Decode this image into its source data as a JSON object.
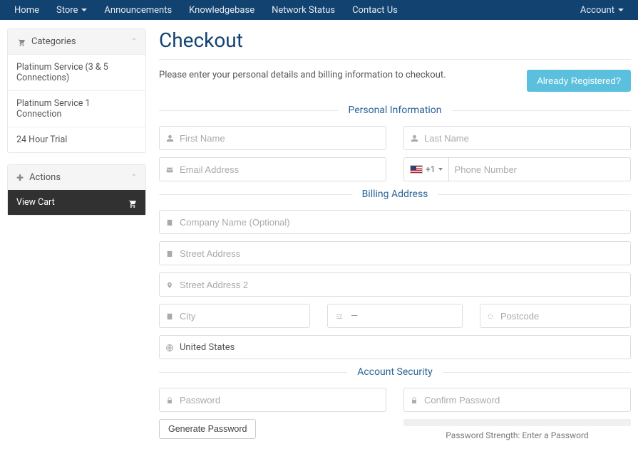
{
  "nav": {
    "left": [
      "Home",
      "Store",
      "Announcements",
      "Knowledgebase",
      "Network Status",
      "Contact Us"
    ],
    "right": "Account"
  },
  "sidebar": {
    "categories": {
      "title": "Categories",
      "items": [
        "Platinum Service (3 & 5 Connections)",
        "Platinum Service 1 Connection",
        "24 Hour Trial"
      ]
    },
    "actions": {
      "title": "Actions",
      "viewCart": "View Cart"
    }
  },
  "page": {
    "title": "Checkout",
    "subhead": "Please enter your personal details and billing information to checkout.",
    "already": "Already Registered?"
  },
  "sections": {
    "personal": "Personal Information",
    "billing": "Billing Address",
    "security": "Account Security"
  },
  "fields": {
    "firstName": "First Name",
    "lastName": "Last Name",
    "email": "Email Address",
    "phone": "Phone Number",
    "code": "+1",
    "company": "Company Name (Optional)",
    "street1": "Street Address",
    "street2": "Street Address 2",
    "city": "City",
    "stateDash": "—",
    "postcode": "Postcode",
    "country": "United States",
    "password": "Password",
    "confirm": "Confirm Password",
    "genPassword": "Generate Password",
    "pwStrength": "Password Strength: Enter a Password"
  }
}
